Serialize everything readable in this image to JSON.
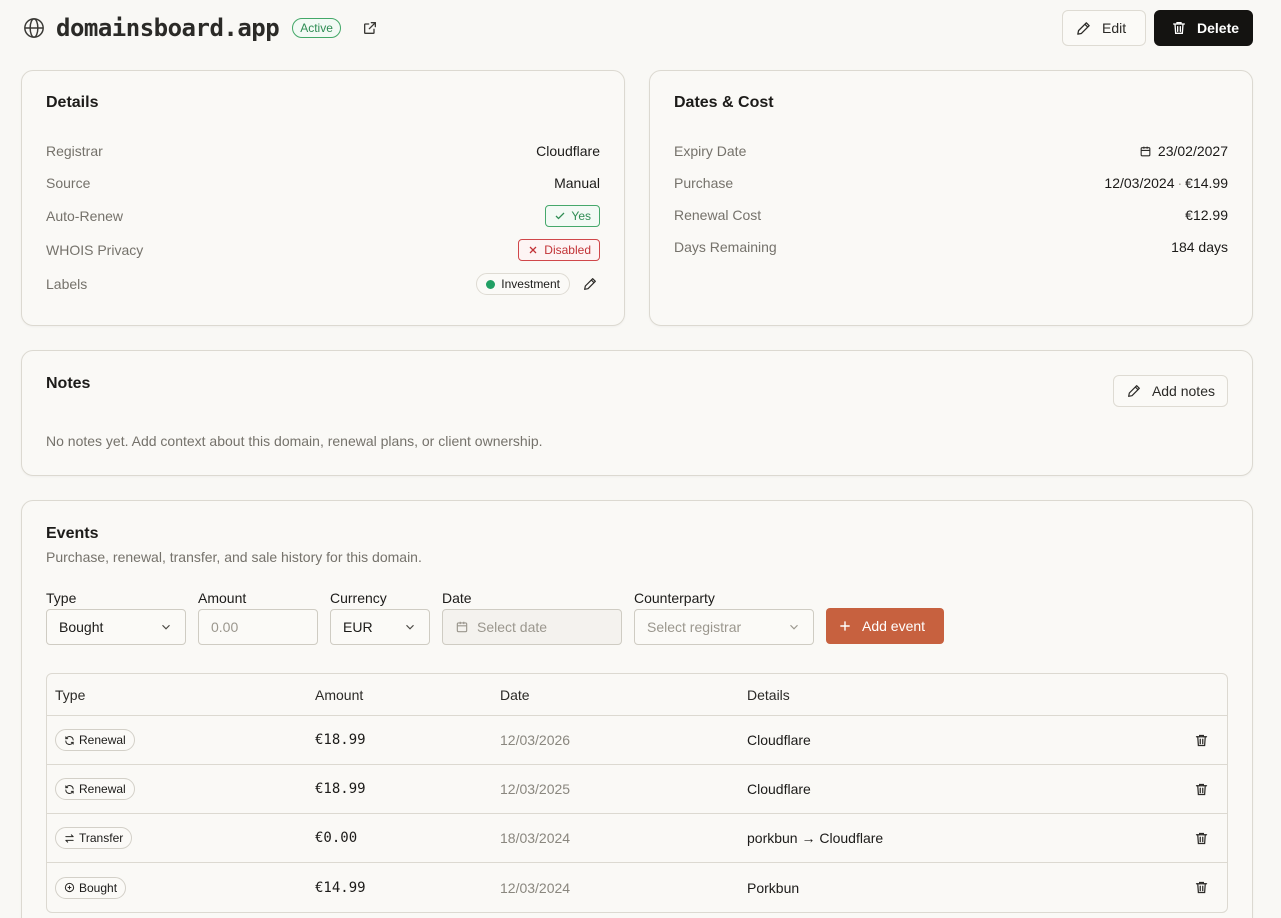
{
  "header": {
    "domain": "domainsboard.app",
    "status": "Active",
    "edit_label": "Edit",
    "delete_label": "Delete"
  },
  "details": {
    "title": "Details",
    "registrar_label": "Registrar",
    "registrar_value": "Cloudflare",
    "source_label": "Source",
    "source_value": "Manual",
    "autorenew_label": "Auto-Renew",
    "autorenew_value": "Yes",
    "whois_label": "WHOIS Privacy",
    "whois_value": "Disabled",
    "labels_label": "Labels",
    "label_name": "Investment",
    "label_color": "#22a065"
  },
  "dates": {
    "title": "Dates & Cost",
    "expiry_label": "Expiry Date",
    "expiry_value": "23/02/2027",
    "purchase_label": "Purchase",
    "purchase_date": "12/03/2024",
    "purchase_sep": "·",
    "purchase_price": "€14.99",
    "renewal_label": "Renewal Cost",
    "renewal_value": "€12.99",
    "remaining_label": "Days Remaining",
    "remaining_value": "184 days"
  },
  "notes": {
    "title": "Notes",
    "add_label": "Add notes",
    "empty_text": "No notes yet. Add context about this domain, renewal plans, or client ownership."
  },
  "events": {
    "title": "Events",
    "subtitle": "Purchase, renewal, transfer, and sale history for this domain.",
    "form": {
      "type_label": "Type",
      "type_value": "Bought",
      "amount_label": "Amount",
      "amount_placeholder": "0.00",
      "currency_label": "Currency",
      "currency_value": "EUR",
      "date_label": "Date",
      "date_placeholder": "Select date",
      "counterparty_label": "Counterparty",
      "counterparty_placeholder": "Select registrar",
      "add_label": "Add event"
    },
    "columns": {
      "type": "Type",
      "amount": "Amount",
      "date": "Date",
      "details": "Details"
    },
    "rows": [
      {
        "type": "Renewal",
        "icon": "refresh-icon",
        "amount": "€18.99",
        "date": "12/03/2026",
        "details": "Cloudflare"
      },
      {
        "type": "Renewal",
        "icon": "refresh-icon",
        "amount": "€18.99",
        "date": "12/03/2025",
        "details": "Cloudflare"
      },
      {
        "type": "Transfer",
        "icon": "transfer-icon",
        "amount": "€0.00",
        "date": "18/03/2024",
        "details": "porkbun → Cloudflare"
      },
      {
        "type": "Bought",
        "icon": "plus-circle-icon",
        "amount": "€14.99",
        "date": "12/03/2024",
        "details": "Porkbun"
      }
    ]
  },
  "colors": {
    "accent": "#c7613f",
    "success": "#2f8d54",
    "danger": "#c23236",
    "background": "#f9f8f5"
  }
}
